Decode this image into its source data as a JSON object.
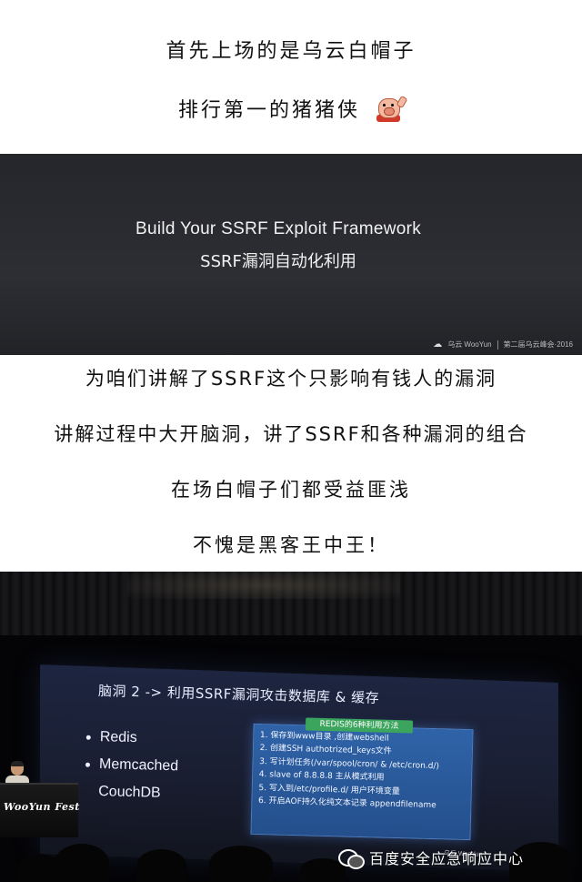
{
  "captions": {
    "line1": "首先上场的是乌云白帽子",
    "line2": "排行第一的猪猪侠",
    "line3": "为咱们讲解了SSRF这个只影响有钱人的漏洞",
    "line4": "讲解过程中大开脑洞，讲了SSRF和各种漏洞的组合",
    "line5": "在场白帽子们都受益匪浅",
    "line6": "不愧是黑客王中王！"
  },
  "slide1": {
    "title_en": "Build Your SSRF Exploit Framework",
    "title_cn": "SSRF漏洞自动化利用",
    "footer_left": "乌云 WooYun",
    "footer_right": "第二届乌云峰会·2016"
  },
  "photo_slide": {
    "title": "脑洞 2 -> 利用SSRF漏洞攻击数据库 & 缓存",
    "bullets": [
      "Redis",
      "Memcached",
      "CouchDB"
    ],
    "panel_title": "REDIS的6种利用方法",
    "panel_items": [
      "1. 保存到www目录 ,创建webshell",
      "2. 创建SSH authotrized_keys文件",
      "3. 写计划任务(/var/spool/cron/ & /etc/cron.d/)",
      "4. slave of 8.8.8.8 主从模式利用",
      "5. 写入到/etc/profile.d/ 用户环境变量",
      "6. 开启AOF持久化纯文本记录 appendfilename"
    ],
    "screen_footer": "乌云 WooYun",
    "podium_logo": "WooYun Fest",
    "watermark": "百度安全应急响应中心"
  },
  "icons": {
    "pig": "pig-hero-icon",
    "cloud": "cloud-icon",
    "wechat": "wechat-icon"
  }
}
